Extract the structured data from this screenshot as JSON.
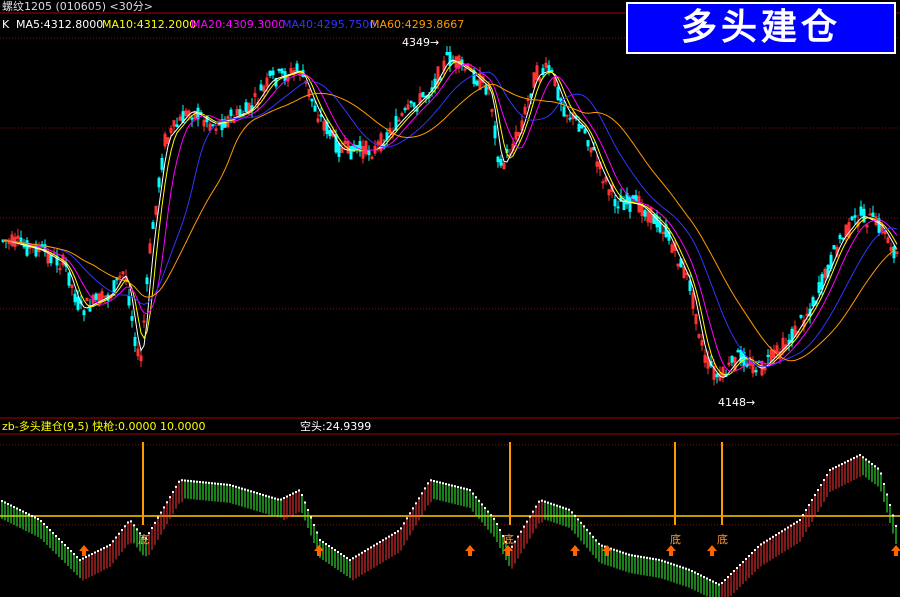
{
  "window_title": "螺纹1205 (010605) <30分>",
  "badge": "多头建仓",
  "main_panel": {
    "prefix": "K",
    "ma_legend": [
      {
        "label": "MA5:4312.8000",
        "color": "#ffffff"
      },
      {
        "label": "MA10:4312.2000",
        "color": "#ffff00"
      },
      {
        "label": "MA20:4309.3000",
        "color": "#ff00ff"
      },
      {
        "label": "MA40:4295.7500",
        "color": "#3333ff"
      },
      {
        "label": "MA60:4293.8667",
        "color": "#ff9900"
      }
    ],
    "high_label": "4349",
    "low_label": "4148"
  },
  "indicator_panel": {
    "title": "zb-多头建仓(9,5) 快枪:0.0000 10.0000",
    "short_label": "空头:24.9399",
    "bottom_marker": "底"
  },
  "chart_data": {
    "type": "candlestick",
    "symbol": "螺纹1205",
    "period": "30分",
    "high": 4349,
    "low": 4148,
    "colors": {
      "up": "#ff3333",
      "down": "#00ffff",
      "ma5": "#ffffff",
      "ma10": "#ffff00",
      "ma20": "#ff00ff",
      "ma40": "#3333ff",
      "ma60": "#ff9900"
    }
  }
}
